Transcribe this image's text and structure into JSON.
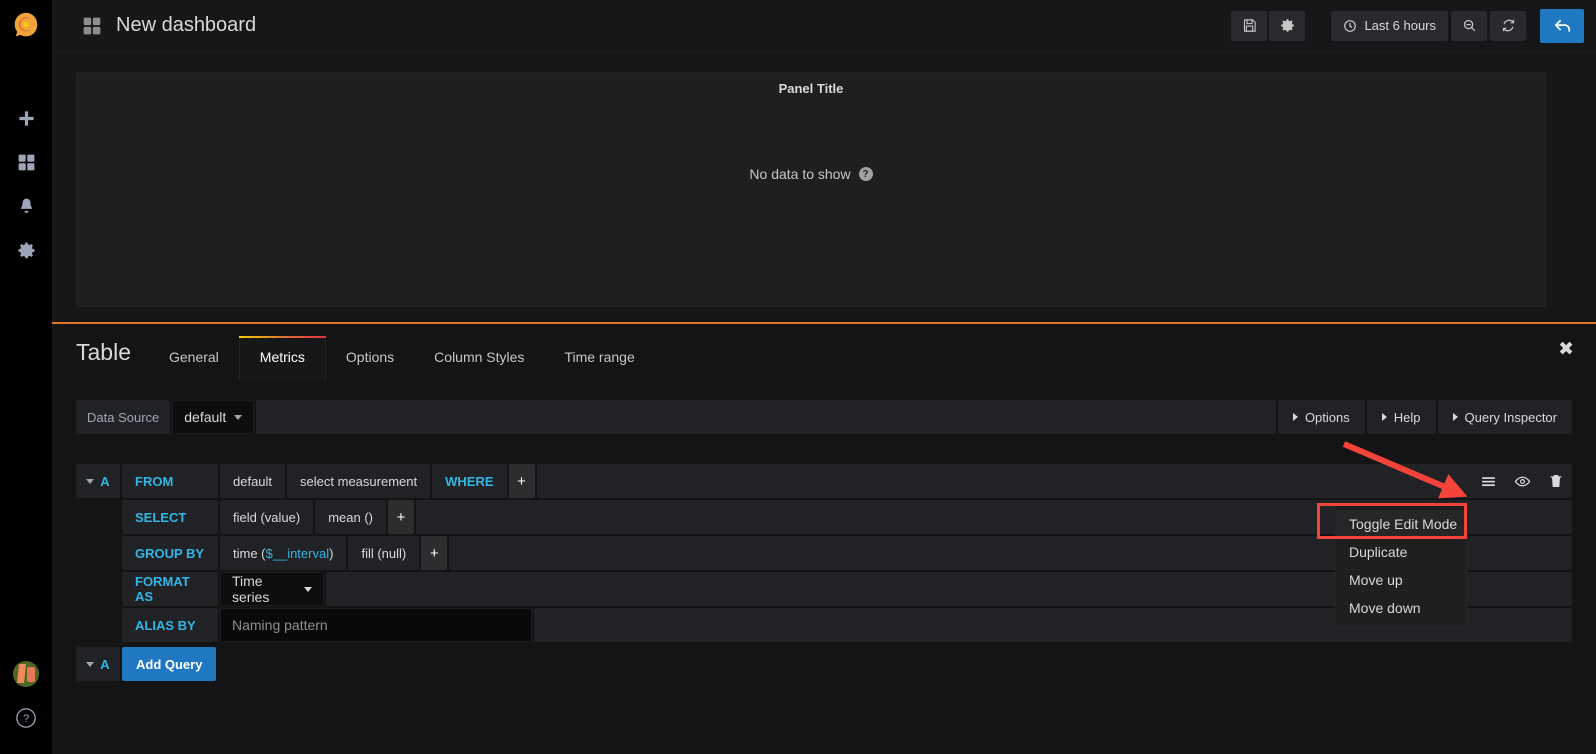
{
  "sidebar": {
    "logo_name": "grafana-logo",
    "top_items": [
      {
        "name": "create-add",
        "icon": "plus-icon"
      },
      {
        "name": "dashboards",
        "icon": "dashboards-icon"
      },
      {
        "name": "alerting",
        "icon": "bell-icon"
      },
      {
        "name": "configuration",
        "icon": "gear-icon"
      }
    ],
    "bottom_items": [
      {
        "name": "user-profile",
        "icon": "avatar-icon"
      },
      {
        "name": "help",
        "icon": "question-circle-icon",
        "glyph": "?"
      }
    ]
  },
  "navbar": {
    "dashboard_icon": "dashboards-icon",
    "title": "New dashboard",
    "save_label": "save-icon",
    "settings_label": "gear-icon",
    "time_picker": "Last 6 hours",
    "zoom_out_label": "zoom-out-icon",
    "refresh_label": "refresh-icon",
    "back_label": "back-arrow-icon"
  },
  "panel": {
    "title": "Panel Title",
    "no_data": "No data to show",
    "help_glyph": "?"
  },
  "editor": {
    "heading": "Table",
    "tabs": [
      {
        "label": "General",
        "active": false
      },
      {
        "label": "Metrics",
        "active": true
      },
      {
        "label": "Options",
        "active": false
      },
      {
        "label": "Column Styles",
        "active": false
      },
      {
        "label": "Time range",
        "active": false
      }
    ],
    "close_glyph": "✖",
    "datasource": {
      "label": "Data Source",
      "value": "default"
    },
    "right_sections": [
      {
        "label": "Options"
      },
      {
        "label": "Help"
      },
      {
        "label": "Query Inspector"
      }
    ],
    "query": {
      "letter": "A",
      "from_key": "FROM",
      "from_retention": "default",
      "from_measurement": "select measurement",
      "from_where": "WHERE",
      "plus_glyph": "+",
      "select_key": "SELECT",
      "select_field": "field (value)",
      "select_mean": "mean ()",
      "groupby_key": "GROUP BY",
      "groupby_time_prefix": "time (",
      "groupby_time_token": "$__interval",
      "groupby_time_suffix": ")",
      "groupby_fill": "fill (null)",
      "format_key": "FORMAT AS",
      "format_value": "Time series",
      "alias_key": "ALIAS BY",
      "alias_placeholder": "Naming pattern",
      "actions": [
        {
          "name": "query-menu",
          "icon": "hamburger-icon"
        },
        {
          "name": "toggle-visibility",
          "icon": "eye-icon"
        },
        {
          "name": "remove-query",
          "icon": "trash-icon"
        }
      ]
    },
    "add_query": {
      "letter": "A",
      "label": "Add Query"
    },
    "context_menu": [
      {
        "label": "Toggle Edit Mode",
        "highlighted": true
      },
      {
        "label": "Duplicate",
        "highlighted": false
      },
      {
        "label": "Move up",
        "highlighted": false
      },
      {
        "label": "Move down",
        "highlighted": false
      }
    ]
  },
  "colors": {
    "accent_blue": "#1f78c1",
    "link_blue": "#33b5e5",
    "annotation_red": "#f4433a",
    "tab_gradient_start": "#f2cc0c",
    "tab_gradient_end": "#e02f44"
  }
}
